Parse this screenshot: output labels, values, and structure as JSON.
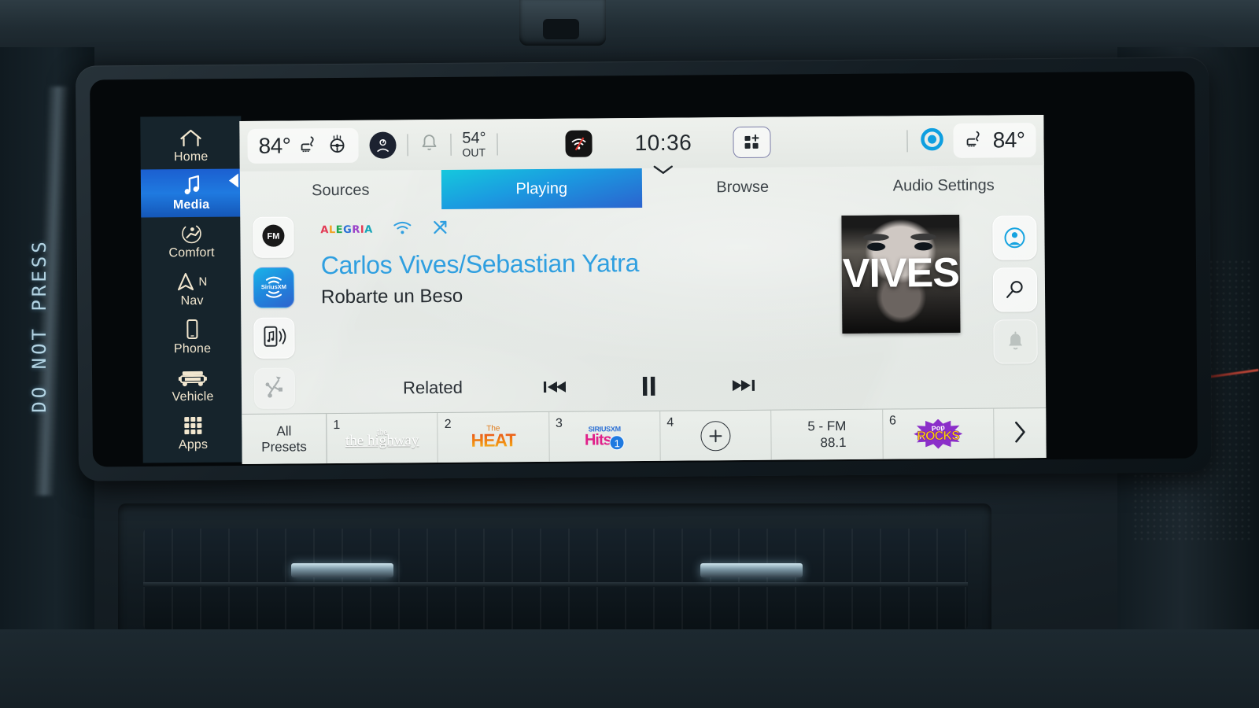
{
  "bezel": {
    "warning_label": "DO NOT PRESS"
  },
  "sidebar": {
    "items": [
      {
        "label": "Home",
        "icon": "home-icon",
        "active": false
      },
      {
        "label": "Media",
        "icon": "music-note-icon",
        "active": true
      },
      {
        "label": "Comfort",
        "icon": "comfort-seat-icon",
        "active": false
      },
      {
        "label": "Nav",
        "icon": "navigation-arrow-icon",
        "badge": "N",
        "active": false
      },
      {
        "label": "Phone",
        "icon": "phone-icon",
        "active": false
      },
      {
        "label": "Vehicle",
        "icon": "truck-icon",
        "active": false
      },
      {
        "label": "Apps",
        "icon": "grid-apps-icon",
        "active": false
      }
    ]
  },
  "statusbar": {
    "driver_temp": "84°",
    "seat_heat_icon": "heated-seat-icon",
    "wheel_heat_icon": "heated-steering-wheel-icon",
    "profile_icon": "driver-profile-icon",
    "bell_icon": "notification-bell-icon",
    "outside_temp": "54°",
    "outside_label": "OUT",
    "wifi_icon": "wifi-off-icon",
    "clock": "10:36",
    "clock_caret_icon": "chevron-down-icon",
    "widget_icon": "add-widget-icon",
    "assistant_icon": "voice-assistant-icon",
    "passenger_seat_icon": "heated-seat-icon",
    "passenger_temp": "84°"
  },
  "tabs": [
    {
      "label": "Sources",
      "active": false
    },
    {
      "label": "Playing",
      "active": true
    },
    {
      "label": "Browse",
      "active": false
    },
    {
      "label": "Audio Settings",
      "active": false
    }
  ],
  "sources": [
    {
      "label": "FM",
      "icon": "fm-radio-icon",
      "active": false
    },
    {
      "label": "SiriusXM",
      "icon": "siriusxm-icon",
      "active": true
    },
    {
      "label": "Bluetooth Audio",
      "icon": "phone-media-icon",
      "active": false
    },
    {
      "label": "USB",
      "icon": "usb-icon",
      "active": false,
      "disabled": true
    }
  ],
  "now_playing": {
    "channel_logo": "ALEGRIA",
    "signal_icon": "signal-strength-icon",
    "shuffle_icon": "shuffle-icon",
    "artist": "Carlos Vives/Sebastian Yatra",
    "track": "Robarte un Beso",
    "album_art_text": "VIVES",
    "related_label": "Related",
    "prev_icon": "previous-track-icon",
    "play_pause_icon": "pause-icon",
    "next_icon": "next-track-icon"
  },
  "right_rail": [
    {
      "name": "profile",
      "icon": "user-profile-icon"
    },
    {
      "name": "search",
      "icon": "search-icon"
    },
    {
      "name": "alerts",
      "icon": "bell-icon",
      "muted": true
    }
  ],
  "presets": {
    "all_label_line1": "All",
    "all_label_line2": "Presets",
    "more_icon": "chevron-right-icon",
    "items": [
      {
        "num": "1",
        "type": "logo-highway",
        "title": "the highway",
        "sub": "the"
      },
      {
        "num": "2",
        "type": "logo-heat",
        "title": "HEAT",
        "sub": "The"
      },
      {
        "num": "3",
        "type": "logo-hits",
        "title": "Hits",
        "sub": "SIRIUSXM",
        "badge": "1"
      },
      {
        "num": "4",
        "type": "empty",
        "title": "+"
      },
      {
        "num": "5",
        "type": "fm",
        "title": "5 - FM",
        "sub": "88.1"
      },
      {
        "num": "6",
        "type": "logo-rocks",
        "title": "ROCKS",
        "sub": "Pop"
      }
    ]
  },
  "colors": {
    "accent_blue": "#2f9fe0",
    "tab_gradient_start": "#15c8dd",
    "tab_gradient_end": "#2b63cf",
    "sidebar_active": "#1f7ae0",
    "screen_bg": "#e4e8e4"
  }
}
